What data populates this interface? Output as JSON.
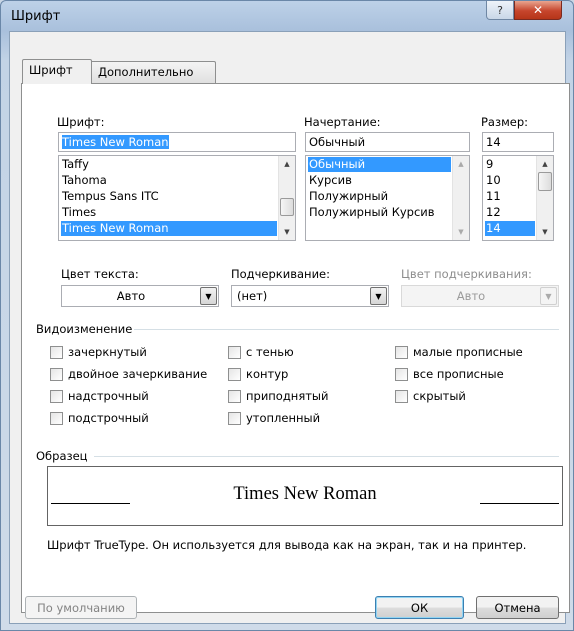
{
  "window": {
    "title": "Шрифт",
    "help_glyph": "?",
    "close_glyph": "✕"
  },
  "tabs": [
    {
      "label": "Шрифт",
      "active": true
    },
    {
      "label": "Дополнительно",
      "active": false
    }
  ],
  "font": {
    "label": "Шрифт:",
    "value": "Times New Roman",
    "list": [
      "Taffy",
      "Tahoma",
      "Tempus Sans ITC",
      "Times",
      "Times New Roman"
    ],
    "selected": "Times New Roman"
  },
  "style": {
    "label": "Начертание:",
    "value": "Обычный",
    "list": [
      "Обычный",
      "Курсив",
      "Полужирный",
      "Полужирный Курсив"
    ],
    "selected": "Обычный"
  },
  "size": {
    "label": "Размер:",
    "value": "14",
    "list": [
      "9",
      "10",
      "11",
      "12",
      "14"
    ],
    "selected": "14"
  },
  "text_color": {
    "label": "Цвет текста:",
    "value": "Авто"
  },
  "underline": {
    "label": "Подчеркивание:",
    "value": "(нет)"
  },
  "underline_color": {
    "label": "Цвет подчеркивания:",
    "value": "Авто",
    "enabled": false
  },
  "effects": {
    "title": "Видоизменение",
    "items": [
      {
        "label": "зачеркнутый",
        "checked": false
      },
      {
        "label": "двойное зачеркивание",
        "checked": false
      },
      {
        "label": "надстрочный",
        "checked": false
      },
      {
        "label": "подстрочный",
        "checked": false
      },
      {
        "label": "с тенью",
        "checked": false
      },
      {
        "label": "контур",
        "checked": false
      },
      {
        "label": "приподнятый",
        "checked": false
      },
      {
        "label": "утопленный",
        "checked": false
      },
      {
        "label": "малые прописные",
        "checked": false
      },
      {
        "label": "все прописные",
        "checked": false
      },
      {
        "label": "скрытый",
        "checked": false
      }
    ]
  },
  "preview": {
    "title": "Образец",
    "text": "Times New Roman",
    "note": "Шрифт TrueType. Он используется для вывода как на экран, так и на принтер."
  },
  "buttons": {
    "default": "По умолчанию",
    "ok": "ОК",
    "cancel": "Отмена"
  },
  "colors": {
    "selection": "#3399ff",
    "title_close": "#c6452c"
  }
}
